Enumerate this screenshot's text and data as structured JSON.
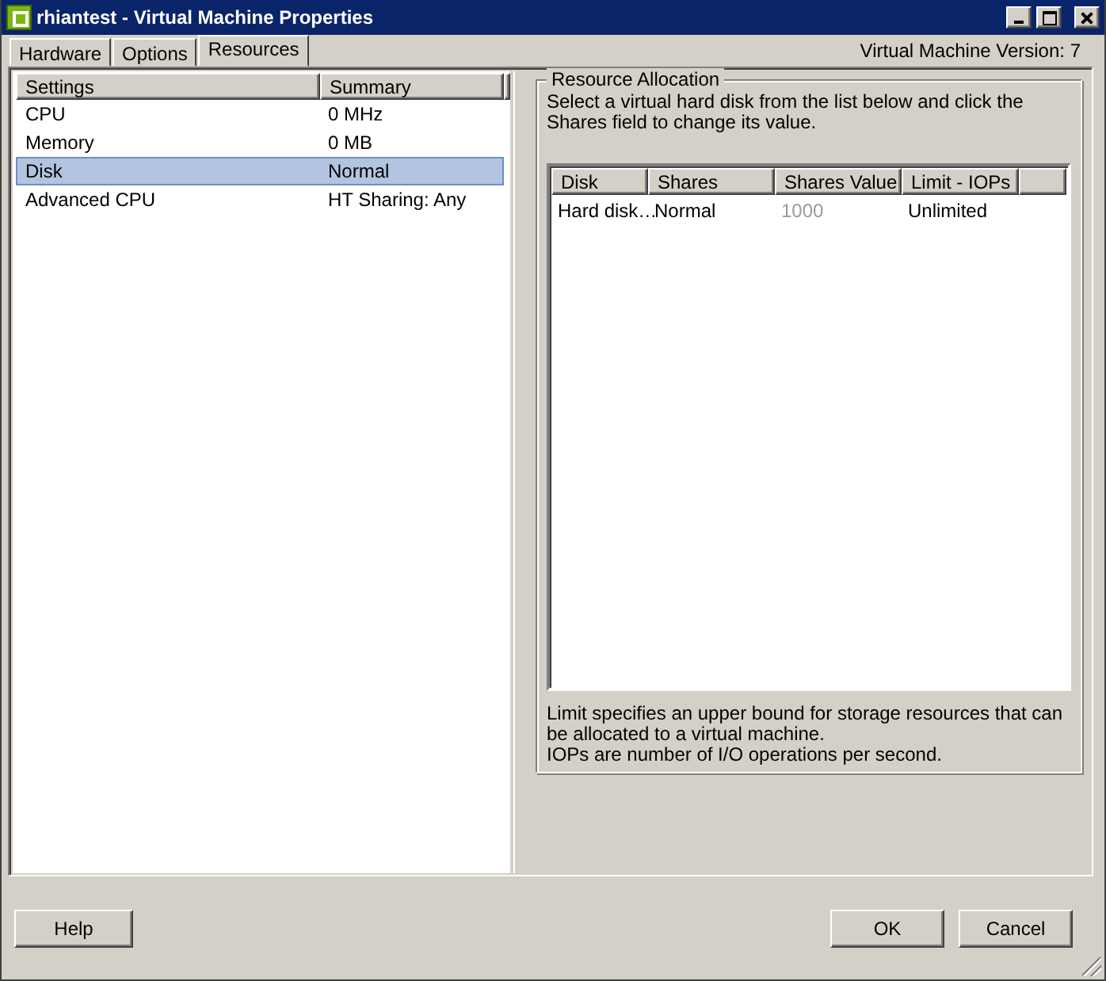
{
  "window": {
    "title": "rhiantest - Virtual Machine Properties"
  },
  "tabs": [
    {
      "label": "Hardware",
      "selected": false
    },
    {
      "label": "Options",
      "selected": false
    },
    {
      "label": "Resources",
      "selected": true
    }
  ],
  "version": "Virtual Machine Version: 7",
  "settings_list": {
    "columns": [
      "Settings",
      "Summary"
    ],
    "rows": [
      {
        "setting": "CPU",
        "summary": "0 MHz",
        "selected": false
      },
      {
        "setting": "Memory",
        "summary": "0 MB",
        "selected": false
      },
      {
        "setting": "Disk",
        "summary": "Normal",
        "selected": true
      },
      {
        "setting": "Advanced CPU",
        "summary": "HT Sharing: Any",
        "selected": false
      }
    ]
  },
  "resource_allocation": {
    "title": "Resource Allocation",
    "instructions": "Select a virtual hard disk from the list below and click the Shares field to change its value.",
    "table": {
      "columns": [
        "Disk",
        "Shares",
        "Shares Value",
        "Limit - IOPs"
      ],
      "rows": [
        {
          "disk": "Hard disk…",
          "shares": "Normal",
          "shares_value": "1000",
          "shares_value_disabled": true,
          "limit": "Unlimited"
        }
      ]
    },
    "notes": [
      "Limit specifies an upper bound for storage resources that can be allocated to a virtual machine.",
      "IOPs are number of I/O operations per second."
    ]
  },
  "buttons": [
    {
      "label": "Help"
    },
    {
      "label": "OK"
    },
    {
      "label": "Cancel"
    }
  ]
}
